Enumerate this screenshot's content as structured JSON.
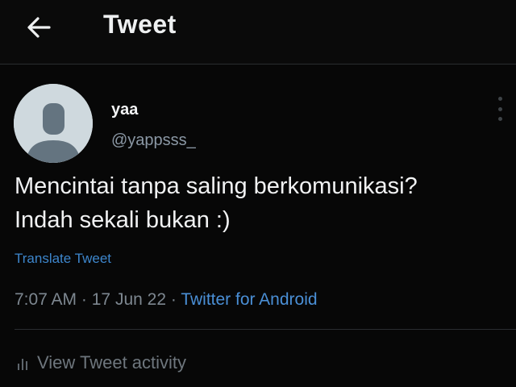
{
  "header": {
    "title": "Tweet",
    "back_icon": "arrow-left-icon"
  },
  "tweet": {
    "display_name": "yaa",
    "handle": "@yappsss_",
    "text_line1": "Mencintai tanpa saling berkomunikasi?",
    "text_line2": "Indah sekali bukan :)",
    "translate_label": "Translate Tweet",
    "time": "7:07 AM",
    "date": "17 Jun 22",
    "source": "Twitter for Android",
    "separator": "·",
    "more_icon": "more-vertical-icon"
  },
  "activity": {
    "label": "View Tweet activity",
    "icon": "analytics-icon"
  },
  "colors": {
    "background": "#070707",
    "link": "#4a8fd6",
    "muted": "#7d8790",
    "avatar": "#cfd9de"
  }
}
